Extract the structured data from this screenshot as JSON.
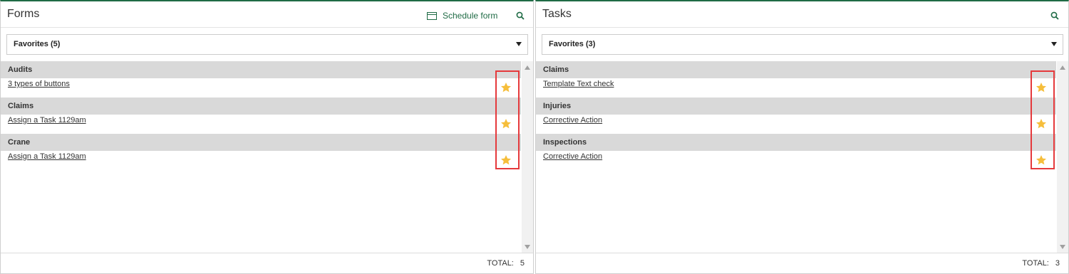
{
  "colors": {
    "accent": "#1f6b45",
    "star": "#f6be3b",
    "highlight": "#e5393c",
    "group_header_bg": "#d9d9d9"
  },
  "forms": {
    "title": "Forms",
    "schedule_label": "Schedule form",
    "schedule_icon": "calendar-icon",
    "search_icon": "search-icon",
    "dropdown_label": "Favorites (5)",
    "groups": [
      {
        "name": "Audits",
        "items": [
          {
            "label": "3 types of buttons",
            "favorite": true
          }
        ]
      },
      {
        "name": "Claims",
        "items": [
          {
            "label": "Assign a Task 1129am",
            "favorite": true
          }
        ]
      },
      {
        "name": "Crane",
        "items": [
          {
            "label": "Assign a Task 1129am",
            "favorite": true
          }
        ]
      }
    ],
    "total_label": "TOTAL:",
    "total_value": "5"
  },
  "tasks": {
    "title": "Tasks",
    "search_icon": "search-icon",
    "dropdown_label": "Favorites (3)",
    "groups": [
      {
        "name": "Claims",
        "items": [
          {
            "label": "Template Text check",
            "favorite": true
          }
        ]
      },
      {
        "name": "Injuries",
        "items": [
          {
            "label": "Corrective Action",
            "favorite": true
          }
        ]
      },
      {
        "name": "Inspections",
        "items": [
          {
            "label": "Corrective Action",
            "favorite": true
          }
        ]
      }
    ],
    "total_label": "TOTAL:",
    "total_value": "3"
  }
}
